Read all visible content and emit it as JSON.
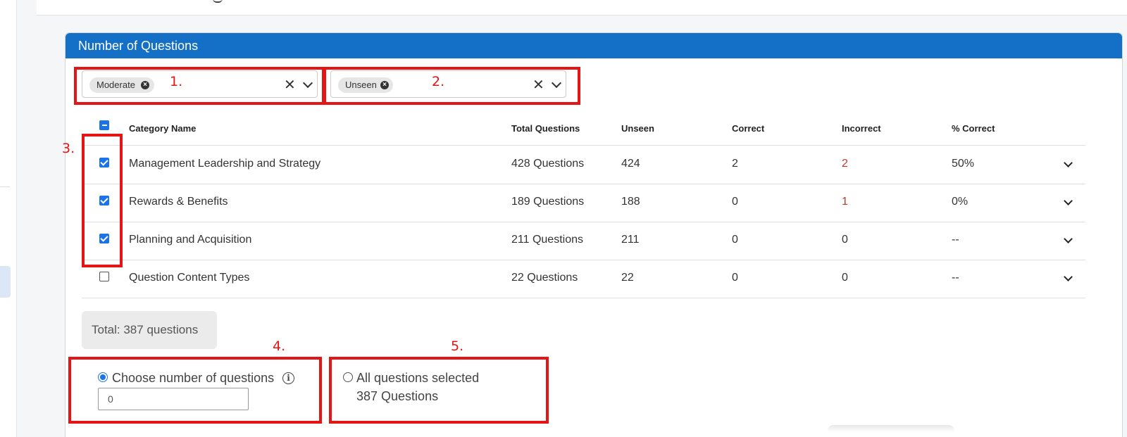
{
  "panel": {
    "title": "Number of Questions"
  },
  "filters": [
    {
      "chip": "Moderate",
      "annotation": "1."
    },
    {
      "chip": "Unseen",
      "annotation": "2."
    }
  ],
  "table": {
    "headers": [
      "Category Name",
      "Total Questions",
      "Unseen",
      "Correct",
      "Incorrect",
      "% Correct"
    ],
    "rows": [
      {
        "name": "Management Leadership and Strategy",
        "total": "428 Questions",
        "unseen": "424",
        "correct": "2",
        "incorrect": "2",
        "pct": "50%",
        "checked": true
      },
      {
        "name": "Rewards & Benefits",
        "total": "189 Questions",
        "unseen": "188",
        "correct": "0",
        "incorrect": "1",
        "pct": "0%",
        "checked": true
      },
      {
        "name": "Planning and Acquisition",
        "total": "211 Questions",
        "unseen": "211",
        "correct": "0",
        "incorrect": "0",
        "pct": "--",
        "checked": true
      },
      {
        "name": "Question Content Types",
        "total": "22 Questions",
        "unseen": "22",
        "correct": "0",
        "incorrect": "0",
        "pct": "--",
        "checked": false
      }
    ],
    "annotation": "3."
  },
  "total": {
    "label": "Total: 387 questions"
  },
  "options": {
    "choose": {
      "label": "Choose number of questions",
      "input_value": "0",
      "annotation": "4.",
      "selected": true
    },
    "all": {
      "label": "All questions selected",
      "sub": "387 Questions",
      "annotation": "5.",
      "selected": false
    }
  },
  "colors": {
    "header_blue": "#1470c7",
    "annotation_red": "#e51515",
    "checkbox_blue": "#1a73e8"
  }
}
